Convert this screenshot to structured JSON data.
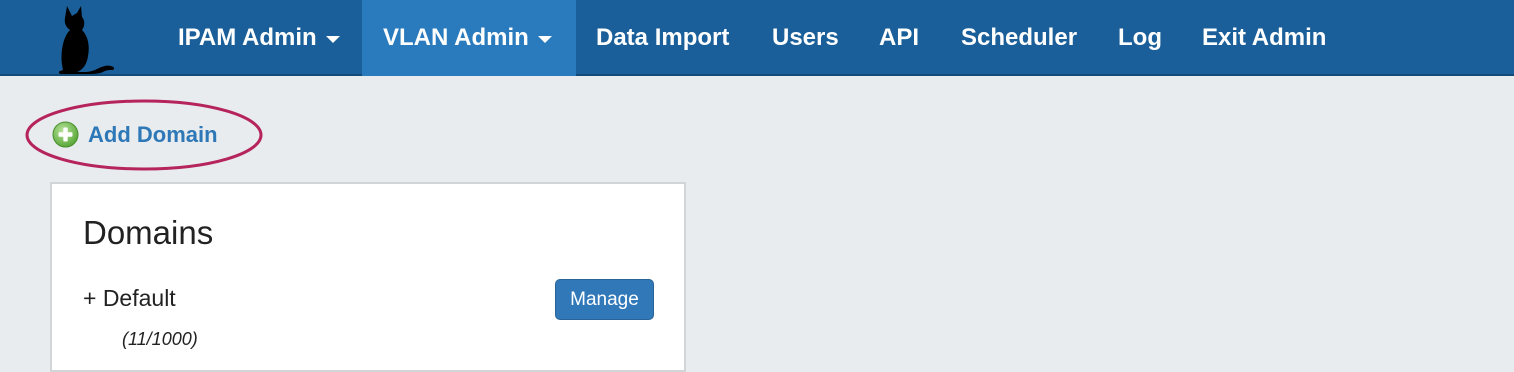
{
  "navbar": {
    "logo_icon": "cat-logo-icon",
    "items": [
      {
        "label": "IPAM Admin",
        "dropdown": true,
        "active": false
      },
      {
        "label": "VLAN Admin",
        "dropdown": true,
        "active": true
      },
      {
        "label": "Data Import"
      },
      {
        "label": "Users"
      },
      {
        "label": "API"
      },
      {
        "label": "Scheduler"
      },
      {
        "label": "Log"
      },
      {
        "label": "Exit Admin"
      }
    ],
    "colors": {
      "background": "#1a5f99",
      "active": "#2a7bbd",
      "text": "#ffffff"
    }
  },
  "actions": {
    "add_domain_label": "Add Domain",
    "add_icon": "add-circle-icon",
    "highlight_color": "#b5245c"
  },
  "domains_panel": {
    "title": "Domains",
    "domains": [
      {
        "prefix": "+",
        "name": "Default",
        "label": "+ Default",
        "count": "(11/1000)",
        "button_label": "Manage"
      }
    ]
  }
}
